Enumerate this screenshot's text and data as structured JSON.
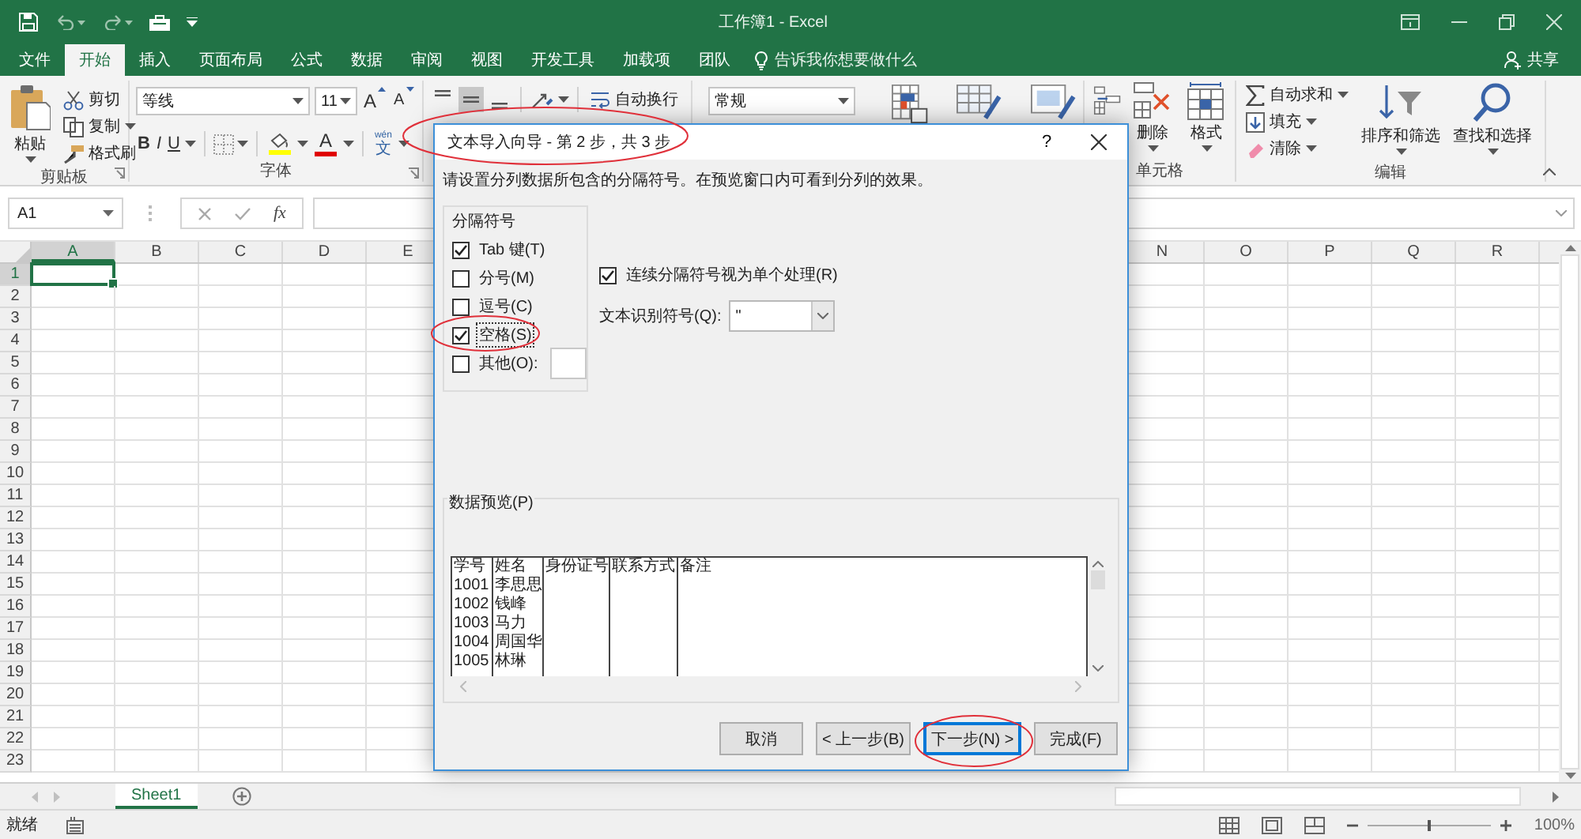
{
  "title_bar": {
    "title": "工作簿1 - Excel"
  },
  "ribbon_tabs": [
    {
      "label": "文件",
      "selected": false
    },
    {
      "label": "开始",
      "selected": true
    },
    {
      "label": "插入",
      "selected": false
    },
    {
      "label": "页面布局",
      "selected": false
    },
    {
      "label": "公式",
      "selected": false
    },
    {
      "label": "数据",
      "selected": false
    },
    {
      "label": "审阅",
      "selected": false
    },
    {
      "label": "视图",
      "selected": false
    },
    {
      "label": "开发工具",
      "selected": false
    },
    {
      "label": "加载项",
      "selected": false
    },
    {
      "label": "团队",
      "selected": false
    }
  ],
  "tell_me": "告诉我你想要做什么",
  "share": "共享",
  "ribbon": {
    "clipboard": {
      "paste": "粘贴",
      "cut": "剪切",
      "copy": "复制",
      "format_painter": "格式刷",
      "label": "剪贴板"
    },
    "font": {
      "font_name": "等线",
      "font_size": "11",
      "grow": "A",
      "shrink": "A",
      "bold": "B",
      "italic": "I",
      "underline": "U",
      "font_color": "A",
      "phonetic_top": "wén",
      "phonetic_bottom": "文",
      "label": "字体"
    },
    "alignment": {
      "vertical": [
        {
          "selected": false
        },
        {
          "selected": true
        },
        {
          "selected": false
        }
      ],
      "wrap_text": "自动换行"
    },
    "number": {
      "format": "常规"
    },
    "cells": {
      "delete": "删除",
      "format": "格式",
      "label": "单元格"
    },
    "editing": {
      "autosum": "自动求和",
      "fill": "填充",
      "clear": "清除",
      "sort_filter": "排序和筛选",
      "find_select": "查找和选择",
      "label": "编辑"
    }
  },
  "formula_bar": {
    "name_box": "A1",
    "function_label": "fx"
  },
  "grid": {
    "columns_left": [
      {
        "label": "A",
        "selected": true
      },
      {
        "label": "B",
        "selected": false
      },
      {
        "label": "C",
        "selected": false
      },
      {
        "label": "D",
        "selected": false
      },
      {
        "label": "E",
        "selected": false
      }
    ],
    "columns_right": [
      {
        "label": "N",
        "selected": false
      },
      {
        "label": "O",
        "selected": false
      },
      {
        "label": "P",
        "selected": false
      },
      {
        "label": "Q",
        "selected": false
      },
      {
        "label": "R",
        "selected": false
      }
    ],
    "rows": [
      {
        "label": "1",
        "selected": true
      },
      {
        "label": "2",
        "selected": false
      },
      {
        "label": "3",
        "selected": false
      },
      {
        "label": "4",
        "selected": false
      },
      {
        "label": "5",
        "selected": false
      },
      {
        "label": "6",
        "selected": false
      },
      {
        "label": "7",
        "selected": false
      },
      {
        "label": "8",
        "selected": false
      },
      {
        "label": "9",
        "selected": false
      },
      {
        "label": "10",
        "selected": false
      },
      {
        "label": "11",
        "selected": false
      },
      {
        "label": "12",
        "selected": false
      },
      {
        "label": "13",
        "selected": false
      },
      {
        "label": "14",
        "selected": false
      },
      {
        "label": "15",
        "selected": false
      },
      {
        "label": "16",
        "selected": false
      },
      {
        "label": "17",
        "selected": false
      },
      {
        "label": "18",
        "selected": false
      },
      {
        "label": "19",
        "selected": false
      },
      {
        "label": "20",
        "selected": false
      },
      {
        "label": "21",
        "selected": false
      },
      {
        "label": "22",
        "selected": false
      },
      {
        "label": "23",
        "selected": false
      }
    ]
  },
  "sheet_tabs": [
    {
      "label": "Sheet1",
      "selected": true
    }
  ],
  "status_bar": {
    "status": "就绪",
    "zoom_slider": {
      "level": 0.5
    },
    "zoom": "100%"
  },
  "dialog": {
    "title": "文本导入向导 - 第 2 步，共 3 步",
    "help": "?",
    "instruction": "请设置分列数据所包含的分隔符号。在预览窗口内可看到分列的效果。",
    "delimiters": {
      "label": "分隔符号",
      "items": [
        {
          "label": "Tab 键(T)",
          "checked": true,
          "focused": false,
          "kind": "checkbox"
        },
        {
          "label": "分号(M)",
          "checked": false,
          "focused": false,
          "kind": "checkbox"
        },
        {
          "label": "逗号(C)",
          "checked": false,
          "focused": false,
          "kind": "checkbox"
        },
        {
          "label": "空格(S)",
          "checked": true,
          "focused": true,
          "kind": "checkbox"
        },
        {
          "label": "其他(O):",
          "checked": false,
          "focused": false,
          "kind": "checkbox_with_field"
        }
      ]
    },
    "consecutive": {
      "label": "连续分隔符号视为单个处理(R)",
      "checked": true
    },
    "text_qualifier": {
      "label": "文本识别符号(Q):",
      "value": "\""
    },
    "preview": {
      "label": "数据预览(P)",
      "rows": [
        [
          "学号",
          "姓名",
          "身份证号",
          "联系方式",
          "备注"
        ],
        [
          "1001",
          "李思思"
        ],
        [
          "1002",
          "钱峰"
        ],
        [
          "1003",
          "马力"
        ],
        [
          "1004",
          "周国华"
        ],
        [
          "1005",
          "林琳"
        ]
      ]
    },
    "buttons": [
      {
        "label": "取消",
        "focused": false
      },
      {
        "label": "< 上一步(B)",
        "focused": false
      },
      {
        "label": "下一步(N) >",
        "focused": true
      },
      {
        "label": "完成(F)",
        "focused": false
      }
    ]
  }
}
